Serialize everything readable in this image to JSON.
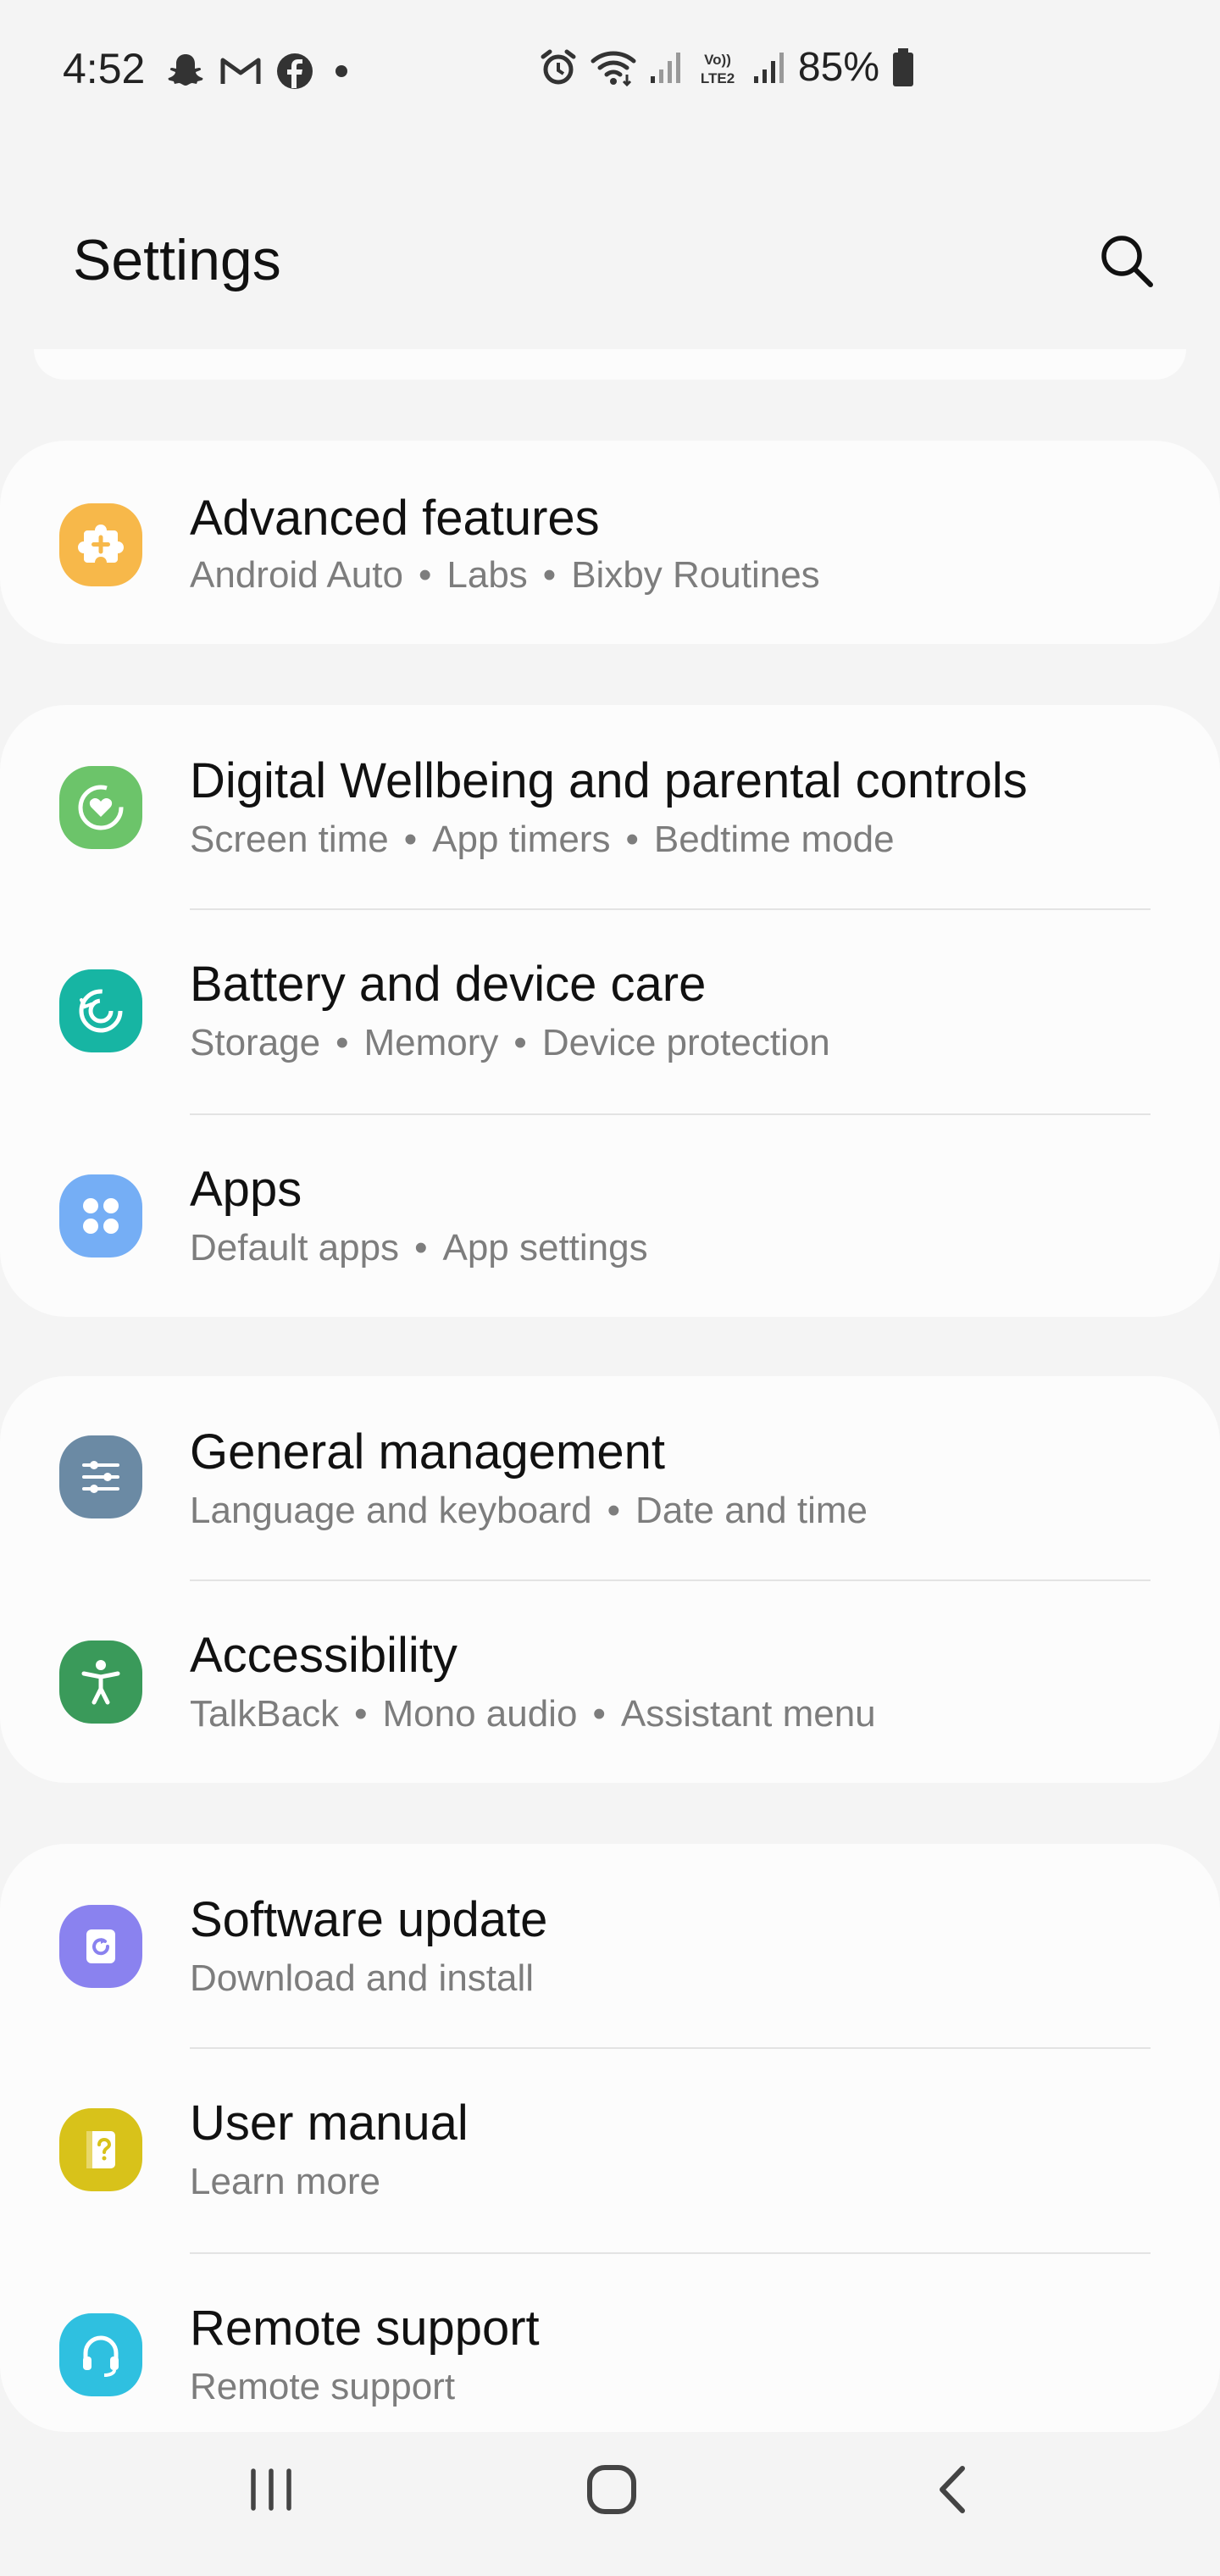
{
  "status_bar": {
    "time": "4:52",
    "left_icons": [
      "snapchat-icon",
      "gmail-icon",
      "facebook-icon",
      "dot-icon"
    ],
    "right_icons": [
      "alarm-icon",
      "wifi-icon",
      "signal-icon",
      "volte-icon",
      "signal-icon"
    ],
    "volte_label": "Vo))\nLTE2",
    "battery": "85%"
  },
  "header": {
    "title": "Settings",
    "search_icon": "search-icon"
  },
  "cards": [
    {
      "items": [
        {
          "id": "advanced-features",
          "title": "Advanced features",
          "subtitle": [
            "Android Auto",
            "Labs",
            "Bixby Routines"
          ],
          "icon": "puzzle-plus-icon",
          "icon_color": "#f7b84a"
        }
      ]
    },
    {
      "items": [
        {
          "id": "digital-wellbeing",
          "title": "Digital Wellbeing and parental controls",
          "subtitle": [
            "Screen time",
            "App timers",
            "Bedtime mode"
          ],
          "icon": "wellbeing-heart-icon",
          "icon_color": "#6cc46a"
        },
        {
          "id": "battery-device-care",
          "title": "Battery and device care",
          "subtitle": [
            "Storage",
            "Memory",
            "Device protection"
          ],
          "icon": "device-care-icon",
          "icon_color": "#17b5a3"
        },
        {
          "id": "apps",
          "title": "Apps",
          "subtitle": [
            "Default apps",
            "App settings"
          ],
          "icon": "apps-grid-icon",
          "icon_color": "#75aef5"
        }
      ]
    },
    {
      "items": [
        {
          "id": "general-management",
          "title": "General management",
          "subtitle": [
            "Language and keyboard",
            "Date and time"
          ],
          "icon": "sliders-icon",
          "icon_color": "#6b8aa4"
        },
        {
          "id": "accessibility",
          "title": "Accessibility",
          "subtitle": [
            "TalkBack",
            "Mono audio",
            "Assistant menu"
          ],
          "icon": "accessibility-person-icon",
          "icon_color": "#3a9a5a"
        }
      ]
    },
    {
      "items": [
        {
          "id": "software-update",
          "title": "Software update",
          "subtitle": [
            "Download and install"
          ],
          "icon": "software-update-icon",
          "icon_color": "#8a82ef"
        },
        {
          "id": "user-manual",
          "title": "User manual",
          "subtitle": [
            "Learn more"
          ],
          "icon": "manual-question-icon",
          "icon_color": "#d8c21a"
        },
        {
          "id": "remote-support",
          "title": "Remote support",
          "subtitle": [
            "Remote support"
          ],
          "icon": "headset-icon",
          "icon_color": "#2fc0e0"
        }
      ]
    }
  ],
  "nav_bar": {
    "recents_icon": "recents-icon",
    "home_icon": "home-icon",
    "back_icon": "back-icon"
  }
}
